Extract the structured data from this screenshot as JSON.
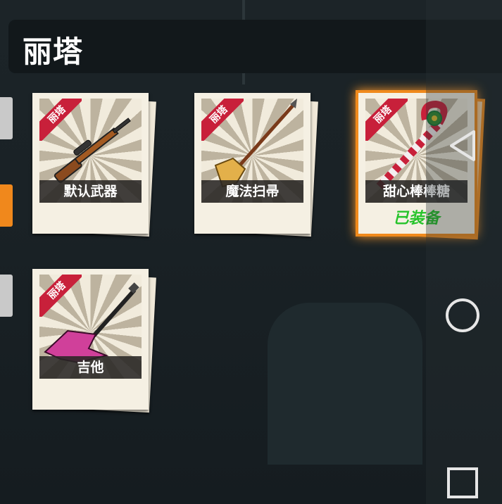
{
  "header": {
    "title": "丽塔"
  },
  "items": [
    {
      "ribbon": "丽塔",
      "name": "默认武器",
      "equipped": ""
    },
    {
      "ribbon": "丽塔",
      "name": "魔法扫帚",
      "equipped": ""
    },
    {
      "ribbon": "丽塔",
      "name": "甜心棒棒糖",
      "equipped": "已装备"
    },
    {
      "ribbon": "丽塔",
      "name": "吉他",
      "equipped": ""
    }
  ],
  "colors": {
    "accent": "#f08a1c",
    "ribbon": "#c8203a",
    "equipped": "#26c32a"
  },
  "nav": {
    "back": "back-icon",
    "home": "home-icon",
    "recents": "recents-icon"
  }
}
